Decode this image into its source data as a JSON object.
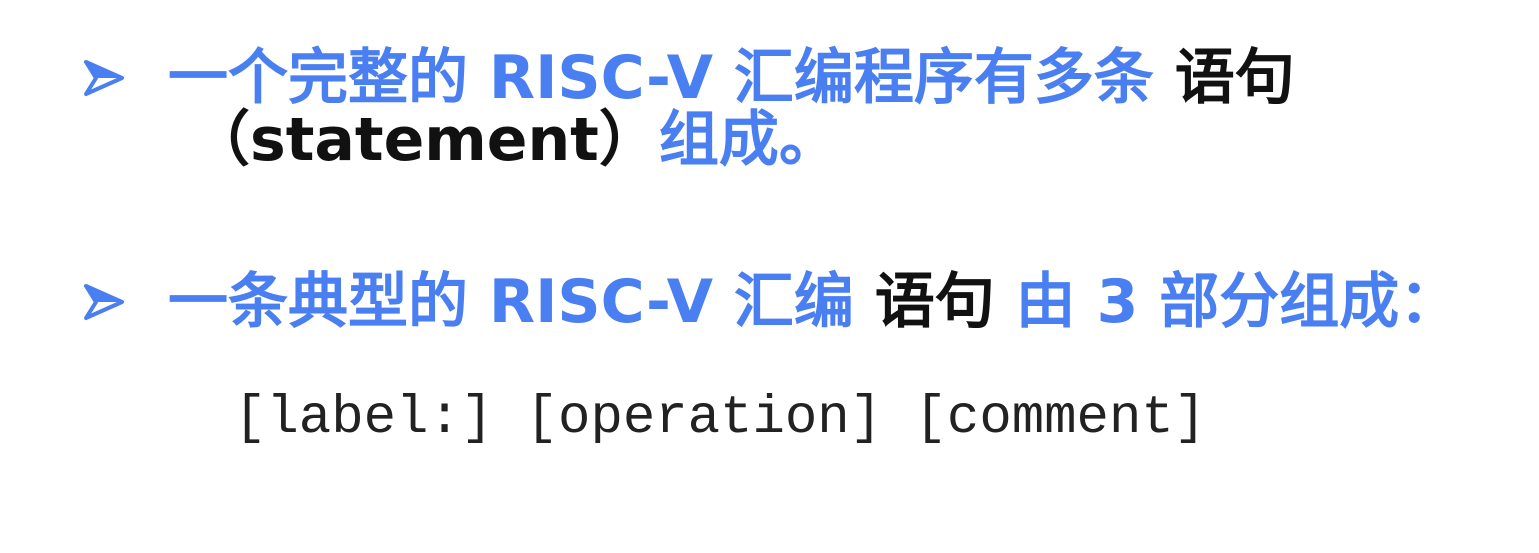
{
  "bullets": [
    {
      "icon": "arrowhead-bullet-icon",
      "segments": [
        {
          "text": "一个完整的 RISC-V 汇编程序有多条 ",
          "color": "blue"
        },
        {
          "text": "语句",
          "color": "black"
        }
      ],
      "continuation": [
        {
          "text": "（statement）",
          "color": "black"
        },
        {
          "text": "组成。",
          "color": "blue"
        }
      ]
    },
    {
      "icon": "arrowhead-bullet-icon",
      "segments": [
        {
          "text": "一条典型的 RISC-V 汇编 ",
          "color": "blue"
        },
        {
          "text": "语句",
          "color": "black"
        },
        {
          "text": " 由 3 部分组成：",
          "color": "blue"
        }
      ]
    }
  ],
  "code_syntax": "[label:] [operation] [comment]",
  "colors": {
    "accent_blue": "#4a7ff2",
    "text_black": "#111111"
  }
}
